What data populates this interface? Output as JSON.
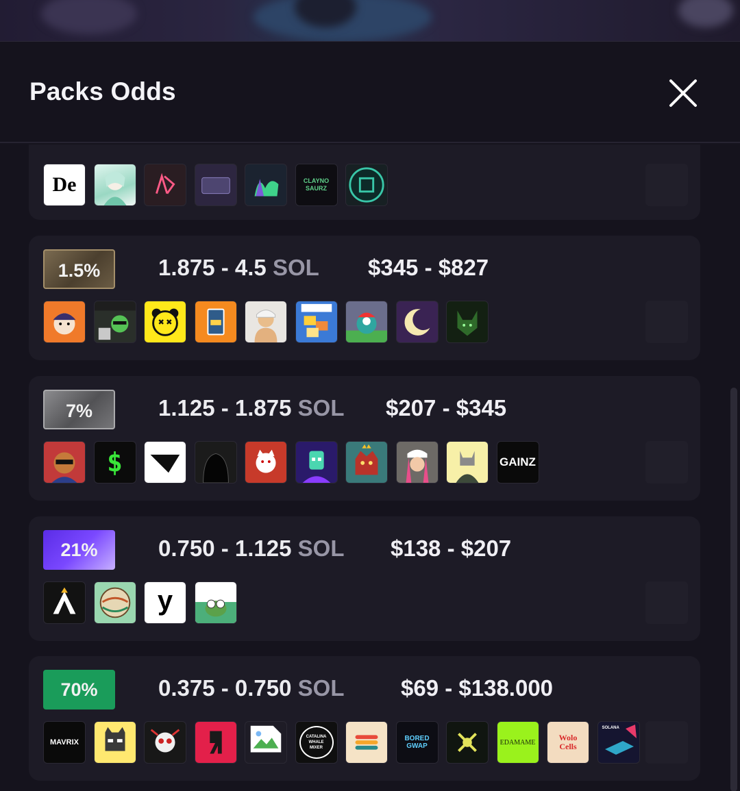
{
  "modal": {
    "title": "Packs Odds"
  },
  "tiers": [
    {
      "badge": "1.5%",
      "sol_range": "1.875 - 4.5",
      "sol_unit": "SOL",
      "usd_range": "$345 - $827"
    },
    {
      "badge": "7%",
      "sol_range": "1.125 - 1.875",
      "sol_unit": "SOL",
      "usd_range": "$207 - $345"
    },
    {
      "badge": "21%",
      "sol_range": "0.750 - 1.125",
      "sol_unit": "SOL",
      "usd_range": "$138 - $207"
    },
    {
      "badge": "70%",
      "sol_range": "0.375 - 0.750",
      "sol_unit": "SOL",
      "usd_range": "$69 - $138.000"
    }
  ],
  "icon_text": {
    "de": "De",
    "clayno": "CLAYNO SAURZ",
    "gainz": "GAINZ",
    "y": "y",
    "mavrix": "MAVRIX",
    "edamame": "EDAMAME",
    "catalina": "CATALINA WHALE MIXER",
    "bored": "BORED GWAP",
    "dollar": "$",
    "solana": "SOLANA",
    "wolo": "Wolo Cells"
  },
  "colors": {
    "tier_gold": "#7a6a50",
    "tier_silver": "#6e6e71",
    "tier_purple": "#6a3cf0",
    "tier_green": "#1a9c5a",
    "accent_sol_unit": "#9896a6"
  }
}
